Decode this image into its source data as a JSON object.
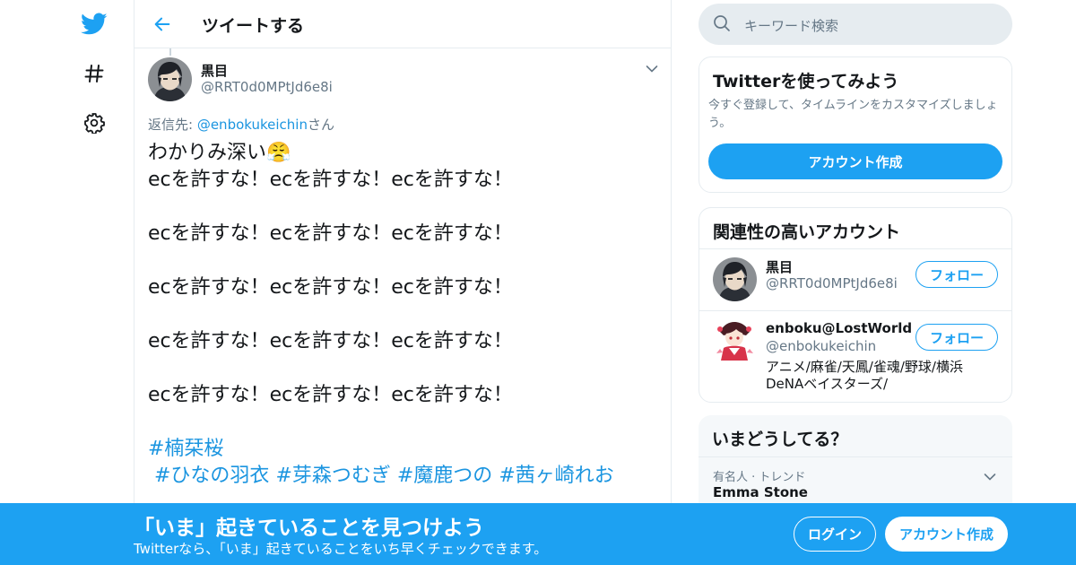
{
  "header": {
    "title": "ツイートする"
  },
  "nav": {
    "icons": [
      "twitter-bird-icon",
      "hashtag-icon",
      "gear-icon"
    ]
  },
  "tweet": {
    "author_name": "黒目",
    "author_handle": "@RRT0d0MPtJd6e8i",
    "reply_prefix": "返信先: ",
    "reply_handle": "@enbokukeichin",
    "reply_suffix": "さん",
    "first_line_text": "わかりみ深い",
    "first_line_emoji": "😤",
    "repeated_line": "ecを許すな！ecを許すな！ecを許すな！",
    "hashtags_line1": [
      "#楠栞桜"
    ],
    "hashtags_line2": [
      "#ひなの羽衣",
      "#芽森つむぎ",
      "#魔鹿つの",
      "#茜ヶ崎れお"
    ]
  },
  "search": {
    "placeholder": "キーワード検索"
  },
  "try_card": {
    "title": "Twitterを使ってみよう",
    "description": "今すぐ登録して、タイムラインをカスタマイズしましょう。",
    "button": "アカウント作成"
  },
  "related": {
    "title": "関連性の高いアカウント",
    "accounts": [
      {
        "name": "黒目",
        "handle": "@RRT0d0MPtJd6e8i",
        "bio": "",
        "follow": "フォロー"
      },
      {
        "name": "enboku@LostWorld",
        "handle": "@enbokukeichin",
        "bio": "アニメ/麻雀/天鳳/雀魂/野球/横浜DeNAベイスターズ/",
        "follow": "フォロー"
      }
    ]
  },
  "trends": {
    "title": "いまどうしてる？",
    "items": [
      {
        "meta": "有名人 · トレンド",
        "name": "Emma Stone"
      }
    ]
  },
  "banner": {
    "title": "「いま」起きていることを見つけよう",
    "subtitle": "Twitterなら、「いま」起きていることをいち早くチェックできます。",
    "login": "ログイン",
    "signup": "アカウント作成"
  },
  "colors": {
    "accent": "#1da1f2",
    "link": "#1b95e0",
    "muted": "#657786",
    "border": "#e6ecf0"
  }
}
